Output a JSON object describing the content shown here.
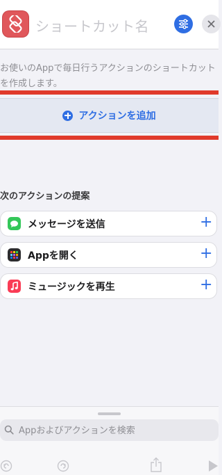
{
  "header": {
    "title_placeholder": "ショートカット名",
    "app_icon": "shortcuts-icon",
    "settings_icon": "sliders-icon",
    "close_icon": "close-icon"
  },
  "description": "お使いのAppで毎日行うアクションのショートカットを作成します。",
  "add_action": {
    "label": "アクションを追加",
    "icon": "plus-circle-icon"
  },
  "suggestions": {
    "title": "次のアクションの提案",
    "items": [
      {
        "label": "メッセージを送信",
        "icon": "messages-icon",
        "color": "#34c759"
      },
      {
        "label": "Appを開く",
        "icon": "app-grid-icon",
        "color": "#2c2c2e"
      },
      {
        "label": "ミュージックを再生",
        "icon": "music-note-icon",
        "color": "#fa3c55"
      }
    ]
  },
  "search": {
    "placeholder": "Appおよびアクションを検索"
  },
  "toolbar": {
    "icons": [
      "undo-icon",
      "redo-icon",
      "share-icon",
      "play-icon"
    ]
  },
  "colors": {
    "accent": "#2f6ee3",
    "highlight": "#e03a2b"
  }
}
